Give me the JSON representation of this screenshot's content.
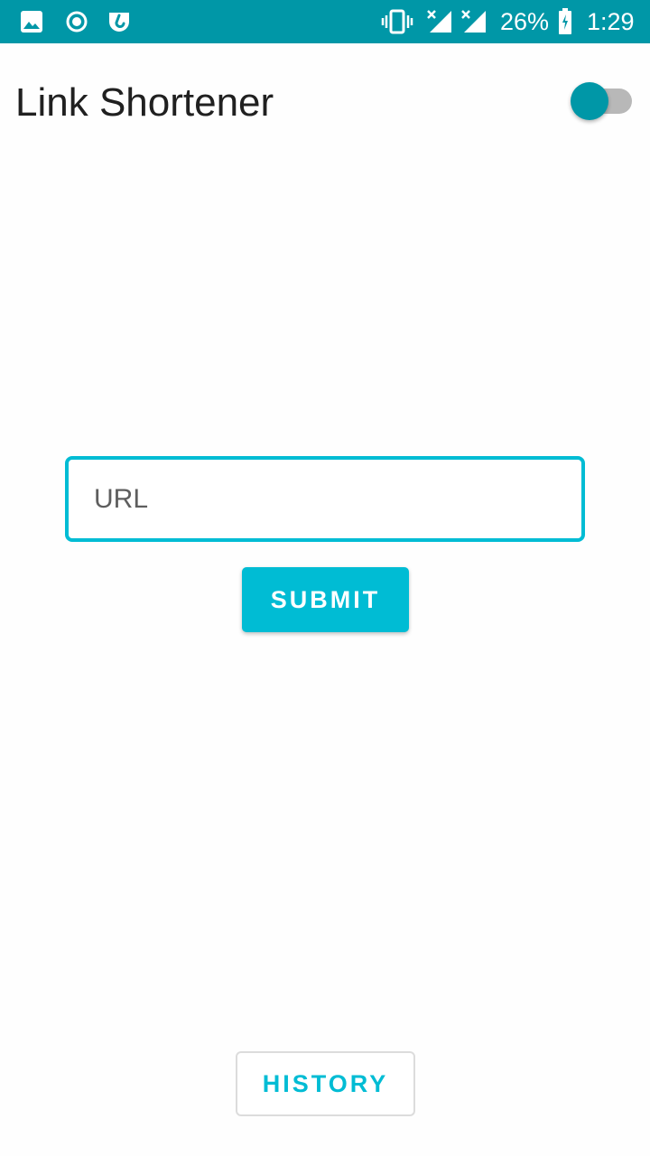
{
  "status_bar": {
    "icons": [
      "image-icon",
      "radio-record-icon",
      "app-notification-icon",
      "vibrate-icon",
      "signal-no-service-icon",
      "signal-no-service-icon",
      "battery-charging-icon"
    ],
    "battery_percent": "26%",
    "time": "1:29"
  },
  "header": {
    "title": "Link Shortener",
    "toggle_state": "on"
  },
  "form": {
    "url_placeholder": "URL",
    "url_value": "",
    "submit_label": "SUBMIT"
  },
  "footer": {
    "history_label": "HISTORY"
  },
  "colors": {
    "status_bar": "#0097a7",
    "accent": "#00bcd4",
    "toggle_thumb": "#0097a7",
    "toggle_track": "#b8b8b8",
    "title_text": "#202020"
  }
}
